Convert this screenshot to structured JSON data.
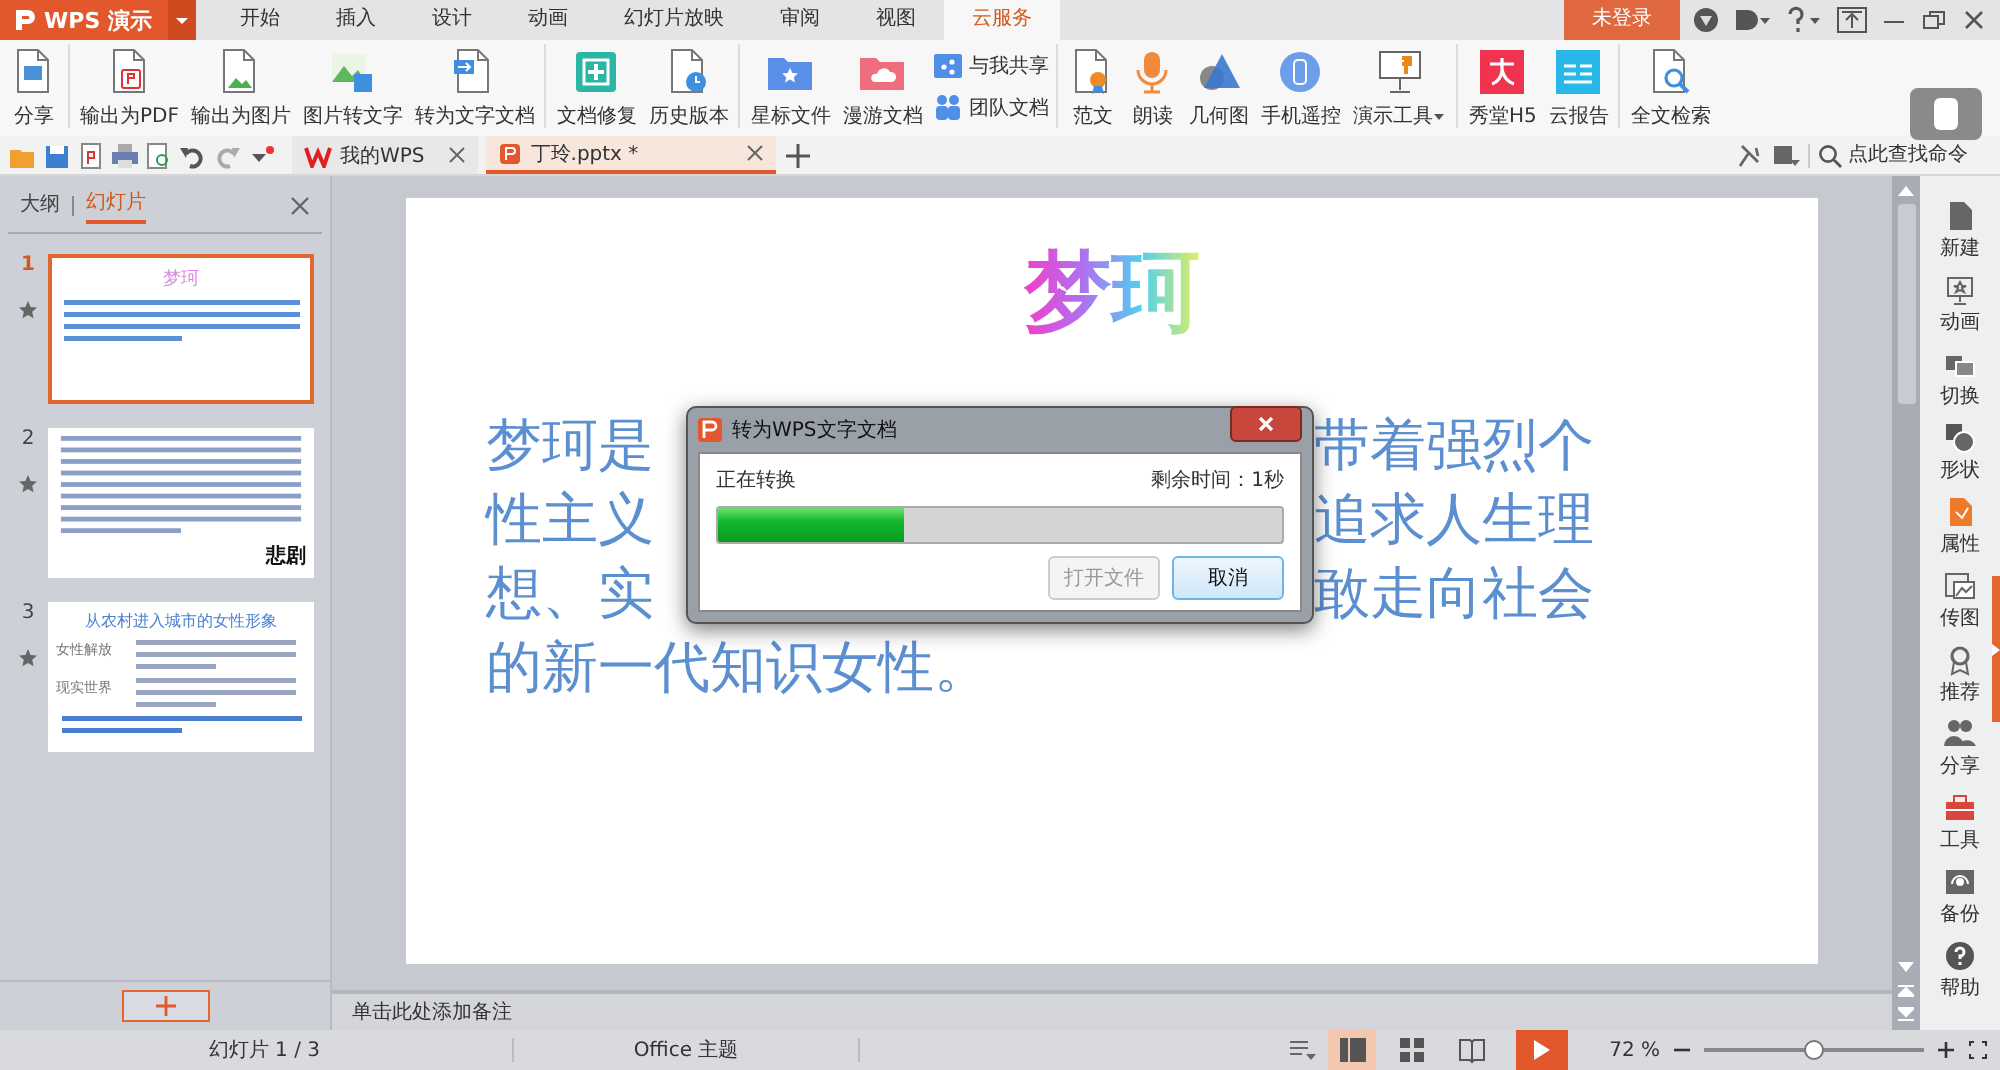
{
  "app_button": {
    "label": "WPS 演示"
  },
  "menu_tabs": [
    {
      "label": "开始",
      "selected": false
    },
    {
      "label": "插入",
      "selected": false
    },
    {
      "label": "设计",
      "selected": false
    },
    {
      "label": "动画",
      "selected": false
    },
    {
      "label": "幻灯片放映",
      "selected": false
    },
    {
      "label": "审阅",
      "selected": false
    },
    {
      "label": "视图",
      "selected": false
    },
    {
      "label": "云服务",
      "selected": true
    }
  ],
  "login_button": {
    "label": "未登录"
  },
  "ribbon": {
    "groups": [
      [
        {
          "label": "分享",
          "kind": "large"
        }
      ],
      [
        {
          "label": "输出为PDF",
          "kind": "large"
        },
        {
          "label": "输出为图片",
          "kind": "large"
        },
        {
          "label": "图片转文字",
          "kind": "large"
        },
        {
          "label": "转为文字文档",
          "kind": "large"
        }
      ],
      [
        {
          "label": "文档修复",
          "kind": "large"
        },
        {
          "label": "历史版本",
          "kind": "large"
        }
      ],
      [
        {
          "label": "星标文件",
          "kind": "large"
        },
        {
          "label": "漫游文档",
          "kind": "large"
        },
        {
          "label": "与我共享",
          "kind": "small"
        },
        {
          "label": "团队文档",
          "kind": "small"
        }
      ],
      [
        {
          "label": "范文",
          "kind": "large"
        },
        {
          "label": "朗读",
          "kind": "large"
        },
        {
          "label": "几何图",
          "kind": "large"
        },
        {
          "label": "手机遥控",
          "kind": "large"
        },
        {
          "label": "演示工具",
          "kind": "dropdown"
        }
      ],
      [
        {
          "label": "秀堂H5",
          "kind": "large"
        },
        {
          "label": "云报告",
          "kind": "large"
        }
      ],
      [
        {
          "label": "全文检索",
          "kind": "large"
        }
      ]
    ]
  },
  "doc_tabs": [
    {
      "label": "我的WPS",
      "selected": false
    },
    {
      "label": "丁玲.pptx *",
      "selected": true
    }
  ],
  "command_search": {
    "placeholder": "点此查找命令"
  },
  "side_panel": {
    "tabs": [
      {
        "label": "大纲",
        "selected": false
      },
      {
        "label": "幻灯片",
        "selected": true
      }
    ],
    "slides": [
      {
        "number": "1",
        "selected": true,
        "kind": "title",
        "texts": [
          "梦珂"
        ]
      },
      {
        "number": "2",
        "selected": false,
        "kind": "dense",
        "texts": [
          "悲剧"
        ]
      },
      {
        "number": "3",
        "selected": false,
        "kind": "sections",
        "texts": [
          "从农村进入城市的女性形象",
          "女性解放",
          "现实世界"
        ]
      }
    ]
  },
  "slide": {
    "title": "梦珂",
    "body_lines": [
      [
        "梦珂是",
        "带着强烈个"
      ],
      [
        "性主义",
        "追求人生理"
      ],
      [
        "想、实",
        "敢走向社会"
      ],
      [
        "的新一代知识女性。"
      ]
    ]
  },
  "notes_hint": "单击此处添加备注",
  "right_sidebar": [
    {
      "label": "新建"
    },
    {
      "label": "动画"
    },
    {
      "label": "切换"
    },
    {
      "label": "形状"
    },
    {
      "label": "属性"
    },
    {
      "label": "传图"
    },
    {
      "label": "推荐"
    },
    {
      "label": "分享"
    },
    {
      "label": "工具"
    },
    {
      "label": "备份"
    },
    {
      "label": "帮助"
    }
  ],
  "status_bar": {
    "slide_counter": "幻灯片 1 / 3",
    "theme": "Office 主题",
    "views": [
      {
        "selected": true
      },
      {
        "selected": false
      },
      {
        "selected": false
      }
    ],
    "zoom": "72 %",
    "zoom_slider": {
      "level": 0.5
    }
  },
  "dialog": {
    "title": "转为WPS文字文档",
    "status": "正在转换",
    "remaining": "剩余时间：1秒",
    "progress": {
      "level": 0.33
    },
    "buttons": [
      {
        "label": "打开文件",
        "disabled": true
      },
      {
        "label": "取消",
        "disabled": false
      }
    ]
  }
}
